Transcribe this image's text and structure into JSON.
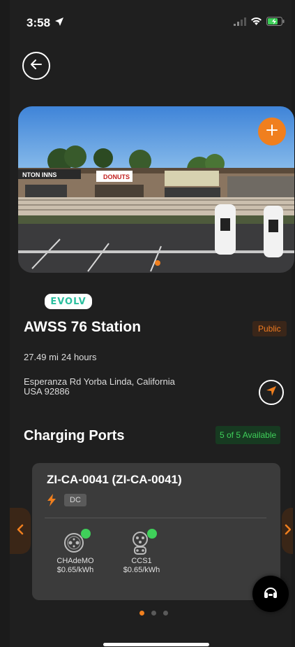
{
  "status_bar": {
    "time": "3:58"
  },
  "station": {
    "brand": "EVOLV",
    "name": "AWSS 76 Station",
    "access": "Public",
    "distance": "27.49 mi",
    "hours": "24 hours",
    "address_line1": "Esperanza Rd Yorba Linda, California",
    "address_line2": "USA 92886"
  },
  "hero": {
    "sign_left": "NTON INNS",
    "sign_center": "DONUTS"
  },
  "ports": {
    "title": "Charging Ports",
    "availability": "5 of 5 Available",
    "card": {
      "id": "ZI-CA-0041 (ZI-CA-0041)",
      "current": "DC",
      "connectors": [
        {
          "name": "CHAdeMO",
          "price": "$0.65/kWh",
          "status_color": "#3fd05a"
        },
        {
          "name": "CCS1",
          "price": "$0.65/kWh",
          "status_color": "#3fd05a"
        }
      ]
    },
    "pager": {
      "count": 3,
      "active": 0
    }
  },
  "colors": {
    "accent": "#f07f1e",
    "available": "#3fd05a",
    "background": "#1f1f1f",
    "card": "#3b3b3b"
  }
}
